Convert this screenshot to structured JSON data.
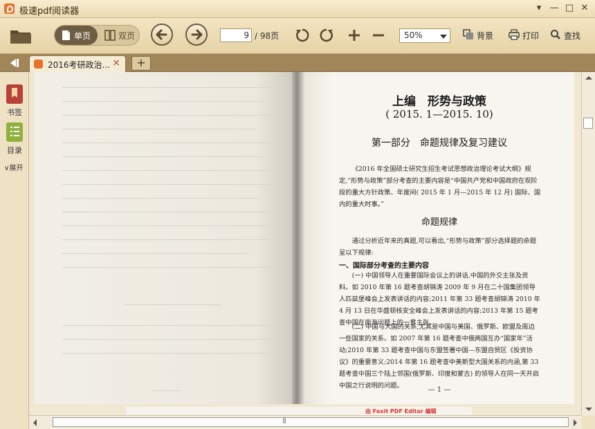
{
  "app": {
    "title": "极速pdf阅读器"
  },
  "window_controls": {
    "menu": "▾",
    "minimize": "—",
    "maximize": "□",
    "close": "✕"
  },
  "toolbar": {
    "view_single": "单页",
    "view_double": "双页",
    "current_page": "9",
    "total_pages": "/ 98页",
    "zoom": "50%",
    "background": "背景",
    "print": "打印",
    "find": "查找"
  },
  "tabs": [
    {
      "label": "2016考研政治...",
      "close": "×"
    }
  ],
  "tab_add": "+",
  "sidebar": {
    "bookmark": "书签",
    "toc": "目录",
    "expand": "展开"
  },
  "document": {
    "part_title": "上编　形势与政策",
    "date_range": "( 2015. 1—2015. 10)",
    "section_title": "第一部分　命题规律及复习建议",
    "intro": "《2016 年全国硕士研究生招生考试思想政治理论考试大纲》规定,“形势与政策”部分考查的主要内容是“中国共产党和中国政府在现阶段的重大方针政策、年度间( 2015 年 1 月—2015 年 12 月) 国际、国内的重大时事。”",
    "subsection_title": "命题规律",
    "analysis": "通过分析近年来的真题,可以看出,“形势与政策”部分选择题的命题呈以下规律:",
    "heading_one": "一、国际部分考查的主要内容",
    "item_one": "(一) 中国领导人在重要国际会议上的讲话,中国的外交主张及资料。如 2010 年第 16 题考查胡锦涛 2009 年 9 月在二十国集团领导人匹兹堡峰会上发表讲话的内容;2011 年第 33 题考查胡锦涛 2010 年 4 月 13 日在华盛顿核安全峰会上发表讲话的内容;2013 年第 15 题考查中国在南海问题上的一贯主张。",
    "item_two": "(二) 中国与大国的关系,尤其是中国与美国、俄罗斯、欧盟及周边一些国家的关系。如 2007 年第 16 题考查中俄两国互办“国家年”活动;2010 年第 33 题考查中国与东盟签署中国—东盟自贸区《投资协议》的重要意义;2014 年第 16 题考查中美新型大国关系的内涵,第 33 题考查中国三个陆上邻国(俄罗斯、印度和蒙古) 的领导人在同一天开启中国之行说明的问题。",
    "page_number": "— 1 —",
    "watermark": "由 Foxit PDF Editor 编辑"
  }
}
